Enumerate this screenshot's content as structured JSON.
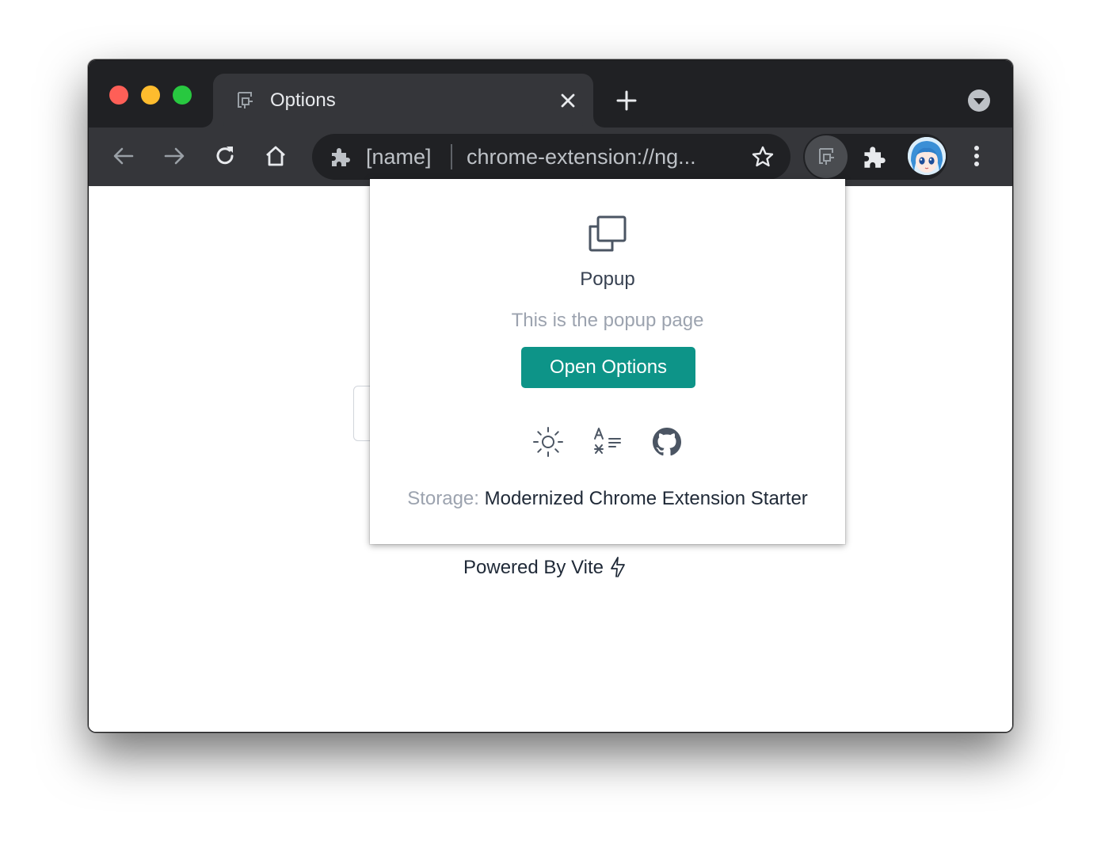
{
  "window": {
    "tab_title": "Options",
    "omnibox": {
      "extension_name": "[name]",
      "url": "chrome-extension://ng..."
    }
  },
  "icons": {
    "tab_favicon": "extension-app-icon",
    "tab_close": "close-icon",
    "new_tab": "plus-icon",
    "tab_menu": "chevron-down-circle-icon",
    "back": "arrow-left-icon",
    "forward": "arrow-right-icon",
    "reload": "reload-icon",
    "home": "home-icon",
    "bookmark": "star-icon",
    "extensions": "puzzle-icon",
    "menu": "kebab-menu-icon"
  },
  "popup": {
    "title": "Popup",
    "description": "This is the popup page",
    "button_label": "Open Options",
    "storage_label": "Storage:",
    "storage_value": "Modernized Chrome Extension Starter"
  },
  "page": {
    "powered_by": "Powered By Vite"
  },
  "colors": {
    "accent": "#0d9488",
    "titlebar": "#202124",
    "toolbar": "#35363a",
    "text_muted": "#9ca3af",
    "text_dark": "#374151"
  }
}
